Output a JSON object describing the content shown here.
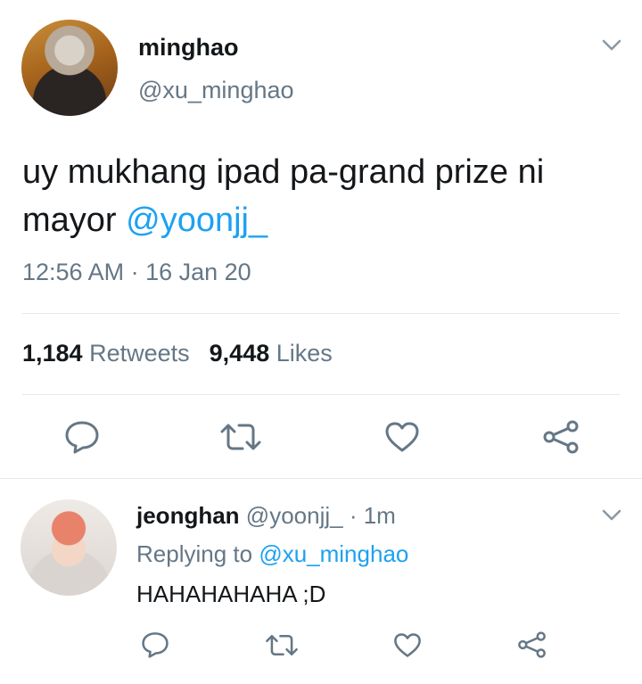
{
  "main_tweet": {
    "author_name": "minghao",
    "author_handle": "@xu_minghao",
    "text_prefix": "uy mukhang ipad pa-grand prize ni mayor ",
    "mention": "@yoonjj_",
    "timestamp": "12:56 AM · 16 Jan 20",
    "retweets_count": "1,184",
    "retweets_label": "Retweets",
    "likes_count": "9,448",
    "likes_label": "Likes"
  },
  "reply_tweet": {
    "author_name": "jeonghan",
    "author_handle": "@yoonjj_",
    "separator": " · ",
    "time": "1m",
    "replying_to_label": "Replying to ",
    "replying_to_handle": "@xu_minghao",
    "text": "HAHAHAHAHA ;D"
  },
  "icons": {
    "more": "chevron-down-icon",
    "reply": "reply-bubble-icon",
    "retweet": "retweet-icon",
    "like": "heart-icon",
    "share": "share-icon"
  },
  "colors": {
    "text": "#14171a",
    "secondary": "#657786",
    "link": "#1da1f2",
    "divider": "#e1e8ed"
  }
}
